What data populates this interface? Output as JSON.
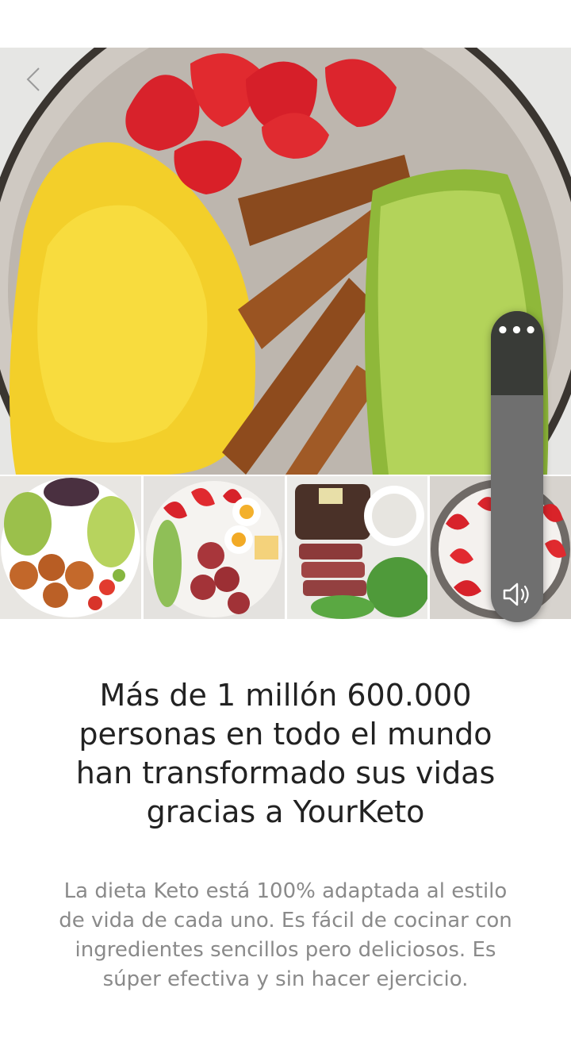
{
  "hero": {
    "image": "keto-breakfast-plate-photo"
  },
  "nav": {
    "back_icon": "chevron-left-icon"
  },
  "thumbnails": [
    {
      "image": "shrimp-avocado-salad-photo"
    },
    {
      "image": "salami-egg-cucumber-platter-photo"
    },
    {
      "image": "steak-salad-dip-photo"
    },
    {
      "image": "strawberry-yogurt-bowl-photo"
    }
  ],
  "volume": {
    "more_label": "•••",
    "level": 0.27,
    "speaker_icon": "speaker-icon"
  },
  "content": {
    "headline": "Más de 1 millón 600.000 personas en todo el mundo han transformado sus vidas gracias a YourKeto",
    "body": "La dieta Keto está 100% adaptada al estilo de vida de cada uno. Es fácil de cocinar con ingredientes sencillos pero deliciosos. Es súper efectiva y sin hacer ejercicio."
  },
  "colors": {
    "headline": "#222222",
    "body": "#8a8a8a",
    "volume_panel": "#6f6f6f",
    "volume_fill": "#393b37"
  }
}
